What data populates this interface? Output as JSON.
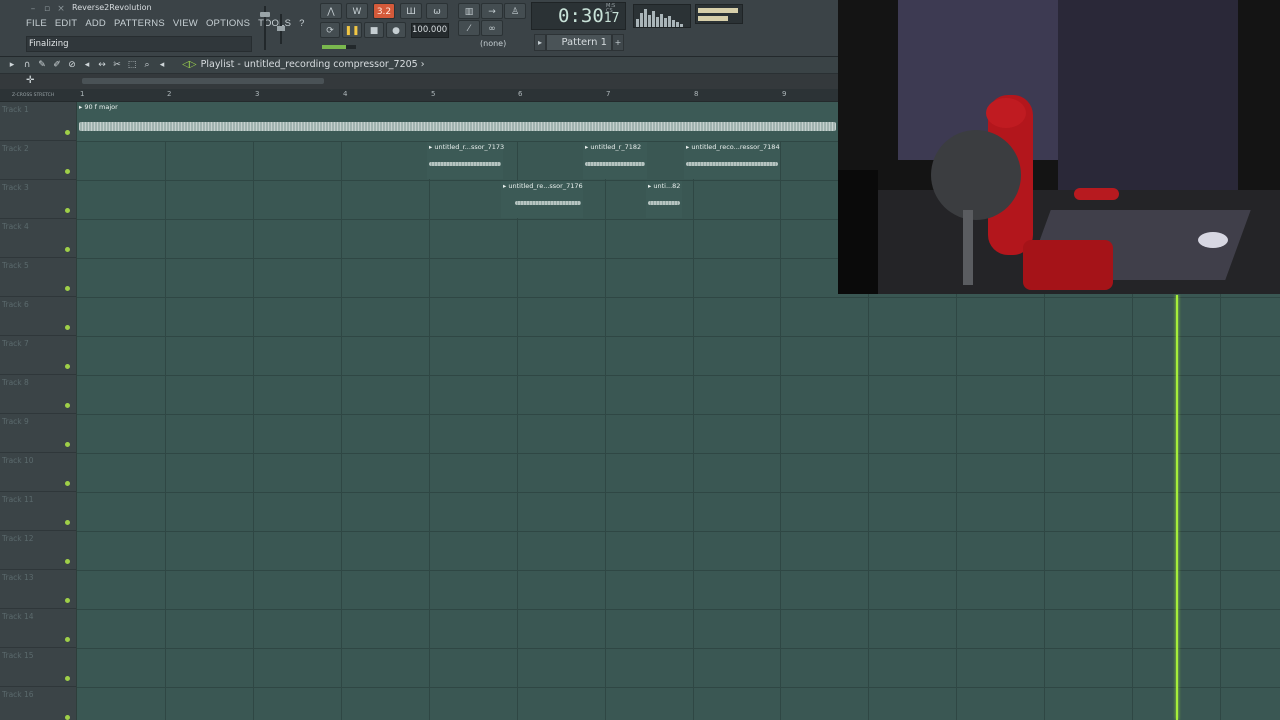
{
  "app": {
    "project_name": "Reverse2Revolution",
    "hint": "Finalizing"
  },
  "menu": [
    "FILE",
    "EDIT",
    "ADD",
    "PATTERNS",
    "VIEW",
    "OPTIONS",
    "TOOLS",
    "?"
  ],
  "transport": {
    "tempo": "100.000",
    "time_main": "0:30",
    "time_small": "17",
    "time_unit_line1": "M:S",
    "time_unit_line2": "CS",
    "pattern_dropdown": "(none)",
    "pattern": "Pattern 1",
    "rec_badge": "3.2"
  },
  "playlist": {
    "title": "Playlist - untitled_recording compressor_7205",
    "title_arrow": "›",
    "ruler_left": "Z-CROSS  STRETCH",
    "bars": [
      "1",
      "2",
      "3",
      "4",
      "5",
      "6",
      "7",
      "8",
      "9"
    ],
    "tracks": [
      "Track 1",
      "Track 2",
      "Track 3",
      "Track 4",
      "Track 5",
      "Track 6",
      "Track 7",
      "Track 8",
      "Track 9",
      "Track 10",
      "Track 11",
      "Track 12",
      "Track 13",
      "Track 14",
      "Track 15",
      "Track 16"
    ],
    "clips": {
      "c1": "90 f major",
      "c2": "untitled_r...ssor_7173",
      "c3": "untitled_r_7182",
      "c4": "untitled_reco...ressor_7184",
      "c5": "untitled_re...ssor_7176",
      "c6": "unti...82"
    }
  },
  "icons": {
    "play": "▸",
    "pause": "❚❚",
    "stop": "■",
    "record": "●",
    "loop": "⟳",
    "pattern_prev": "▸",
    "pattern_add": "+"
  },
  "colors": {
    "grid": "#3a5753",
    "playhead": "#a6ef3a",
    "track_dot": "#9fd048",
    "rec_active": "#d45a3a"
  }
}
